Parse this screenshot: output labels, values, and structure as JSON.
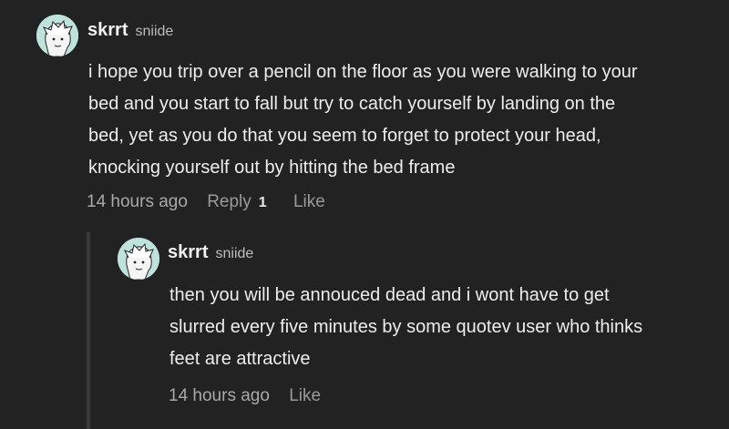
{
  "comments": [
    {
      "username": "skrrt",
      "handle": "sniide",
      "lines": [
        "i hope you trip over a pencil on the floor as you were walking to your",
        "bed and you start to fall but try to catch yourself by landing on the",
        "bed, yet as you do that you seem to forget to protect your head,",
        "knocking yourself out by hitting the bed frame"
      ],
      "time": "14 hours ago",
      "reply_label": "Reply",
      "reply_count": "1",
      "like_label": "Like"
    },
    {
      "username": "skrrt",
      "handle": "sniide",
      "lines": [
        "then you will be annouced dead and i wont have to get",
        "slurred every five minutes by some quotev user who thinks",
        "feet are attractive"
      ],
      "time": "14 hours ago",
      "like_label": "Like"
    }
  ],
  "colors": {
    "background": "#222222",
    "avatar_bg": "#bfe3dc",
    "thread_line": "#3a3a3a"
  }
}
